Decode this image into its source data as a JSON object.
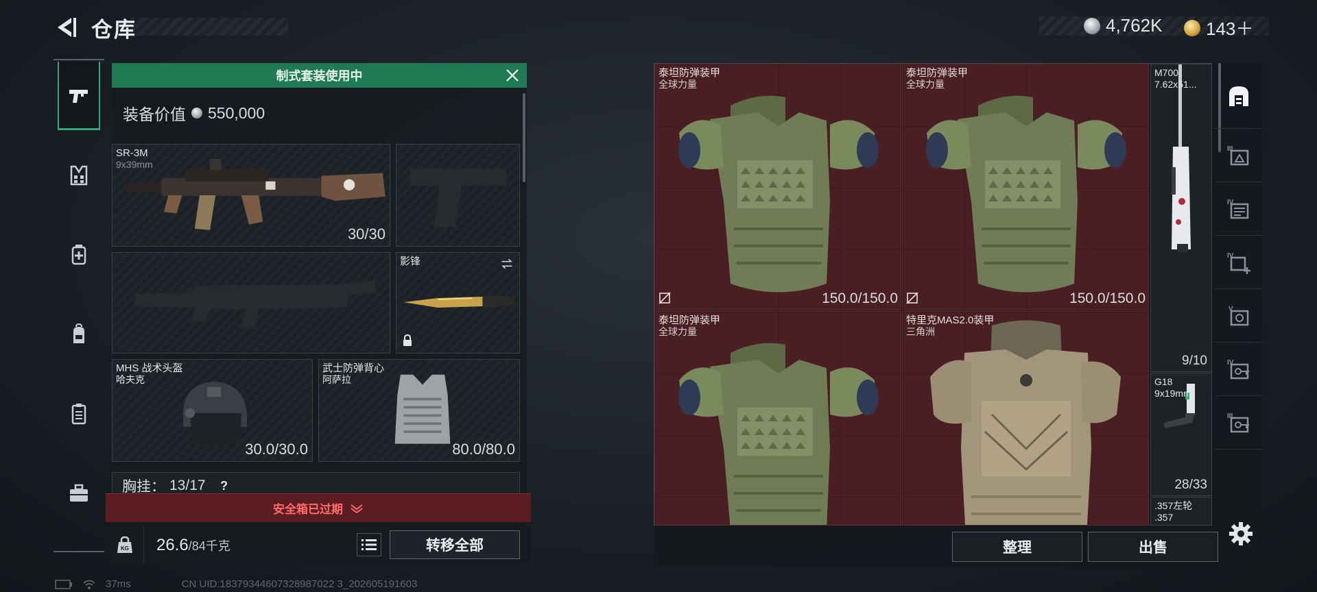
{
  "header": {
    "title": "仓库",
    "currency_silver": "4,762K",
    "currency_gold": "143＋"
  },
  "left_nav": {
    "items": [
      {
        "icon": "pistol-icon",
        "active": true
      },
      {
        "icon": "vest-icon",
        "active": false
      },
      {
        "icon": "medkit-icon",
        "active": false
      },
      {
        "icon": "backpack-icon",
        "active": false
      },
      {
        "icon": "clipboard-icon",
        "active": false
      },
      {
        "icon": "toolbox-icon",
        "active": false
      }
    ]
  },
  "loadout": {
    "banner": "制式套装使用中",
    "equipment_value_label": "装备价值",
    "equipment_value": "550,000",
    "primary": {
      "name": "SR-3M",
      "ammo": "9x39mm",
      "count": "30/30"
    },
    "melee": {
      "name": "影锋"
    },
    "helmet": {
      "name": "MHS 战术头盔",
      "sub": "哈夫克",
      "durability": "30.0/30.0"
    },
    "armor": {
      "name": "武士防弹背心",
      "sub": "阿萨拉",
      "durability": "80.0/80.0"
    },
    "chest_rig_label": "胸挂：",
    "chest_rig_count": "13/17",
    "chest_rig_help": "?",
    "safe_box_expired": "安全箱已过期",
    "weight": "26.6",
    "weight_max": "/84千克",
    "transfer_all": "转移全部"
  },
  "storage": {
    "vests": [
      {
        "name": "泰坦防弹装甲",
        "sub": "全球力量",
        "durability": "150.0/150.0",
        "color": "#7c8a5f"
      },
      {
        "name": "泰坦防弹装甲",
        "sub": "全球力量",
        "durability": "150.0/150.0",
        "color": "#7c8a5f"
      },
      {
        "name": "泰坦防弹装甲",
        "sub": "全球力量",
        "color": "#7c8a5f"
      },
      {
        "name": "特里克MAS2.0装甲",
        "sub": "三角洲",
        "color": "#a89877"
      }
    ],
    "side_items": [
      {
        "name": "M700",
        "sub": "7.62x51...",
        "count": "9/10"
      },
      {
        "name": "G18",
        "sub": "9x19mm",
        "count": "28/33"
      },
      {
        "name": ".357左轮",
        "sub": ".357"
      }
    ],
    "sort_label": "整理",
    "sell_label": "出售"
  },
  "filters": [
    {
      "icon": "storage-home-icon",
      "label": ""
    },
    {
      "icon": "filter-iii-icon",
      "label": "III"
    },
    {
      "icon": "filter-iv-icon",
      "label": "IV"
    },
    {
      "icon": "filter-iv-plus-icon",
      "label": "IV"
    },
    {
      "icon": "filter-v-icon",
      "label": "V"
    },
    {
      "icon": "filter-iv-key-icon",
      "label": "IV"
    },
    {
      "icon": "filter-iii-key-icon",
      "label": "III"
    }
  ],
  "status": {
    "ping": "37ms",
    "uid": "CN UID:18379344607328987022 3_202605191603"
  }
}
